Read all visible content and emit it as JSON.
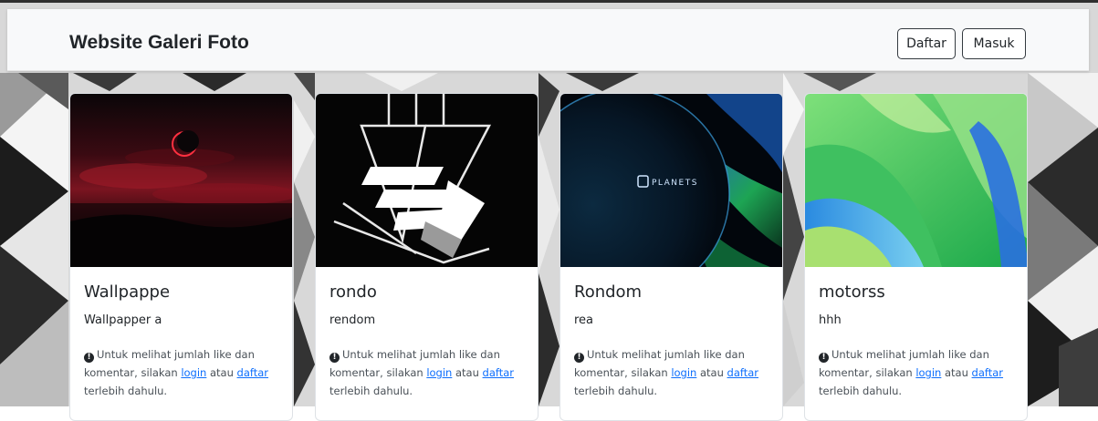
{
  "navbar": {
    "brand": "Website Galeri Foto",
    "register_label": "Daftar",
    "login_label": "Masuk"
  },
  "cards": [
    {
      "title": "Wallpappe",
      "description": "Wallpapper a"
    },
    {
      "title": "rondo",
      "description": "rendom"
    },
    {
      "title": "Rondom",
      "description": "rea"
    },
    {
      "title": "motorss",
      "description": "hhh"
    }
  ],
  "notice": {
    "before": "Untuk melihat jumlah like dan komentar, silakan ",
    "login_link": "login",
    "middle": " atau ",
    "register_link": "daftar",
    "after": " terlebih dahulu."
  },
  "images": {
    "planet_logo_text": "PLANETS"
  },
  "colors": {
    "link": "#0d6efd",
    "navbar_bg": "#f8f9fa"
  }
}
